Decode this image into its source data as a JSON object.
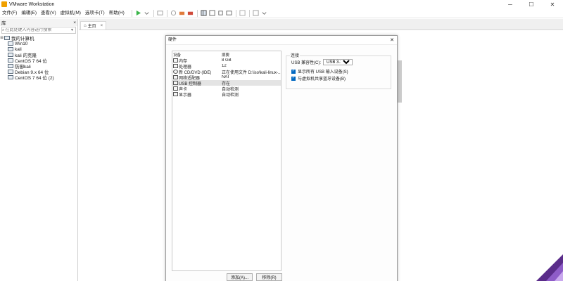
{
  "window": {
    "title": "VMware Workstation"
  },
  "menu": [
    "文件(F)",
    "编辑(E)",
    "查看(V)",
    "虚拟机(M)",
    "选项卡(T)",
    "帮助(H)"
  ],
  "library": {
    "title": "库",
    "close": "×",
    "search_placeholder": "在此处键入内容进行搜索",
    "root": "我的计算机",
    "items": [
      "Win10",
      "kali",
      "kali 的克隆",
      "CentOS 7 64 位",
      "防御kali",
      "Debian 9.x 64 位",
      "CentOS 7 64 位 (2)"
    ]
  },
  "tabs": {
    "home": "主页"
  },
  "dialog": {
    "title": "硬件",
    "columns": {
      "device": "设备",
      "summary": "摘要"
    },
    "devices": [
      {
        "name": "内存",
        "summary": "8 GB"
      },
      {
        "name": "处理器",
        "summary": "12"
      },
      {
        "name": "新 CD/DVD (IDE)",
        "summary": "正在使用文件 D:\\iso\\kali-linux-..."
      },
      {
        "name": "网络适配器",
        "summary": "NAT"
      },
      {
        "name": "USB 控制器",
        "summary": "存在"
      },
      {
        "name": "声卡",
        "summary": "自动检测"
      },
      {
        "name": "显示器",
        "summary": "自动检测"
      }
    ],
    "buttons": {
      "add": "添加(A)...",
      "remove": "移除(R)"
    },
    "connection": {
      "label": "连接",
      "compat_label": "USB 兼容性(C):",
      "compat_value": "USB 3.1",
      "show_all": "显示所有 USB 输入设备(S)",
      "share_bt": "与虚拟机共享蓝牙设备(B)"
    }
  },
  "colors": {
    "accent": "#0067c0",
    "play": "#3bb54a"
  }
}
